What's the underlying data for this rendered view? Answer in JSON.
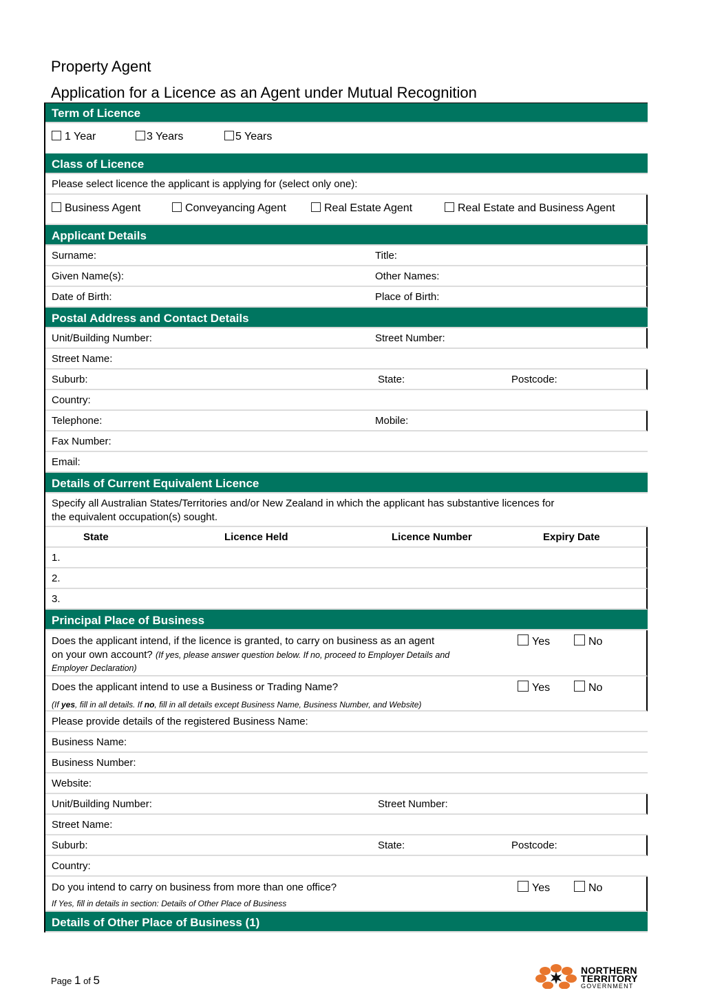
{
  "document": {
    "title": "Property Agent",
    "subtitle": "Application for a Licence as an Agent under Mutual Recognition",
    "accent_color": "#007560"
  },
  "term_of_licence": {
    "heading": "Term of Licence",
    "options": [
      "1 Year",
      "3 Years",
      "5 Years"
    ]
  },
  "class_of_licence": {
    "heading": "Class of Licence",
    "instruction": "Please select licence the applicant is applying for (select only one):",
    "options": [
      "Business Agent",
      "Conveyancing Agent",
      "Real Estate Agent",
      "Real Estate and Business Agent"
    ]
  },
  "applicant_details": {
    "heading": "Applicant Details",
    "surname": "Surname:",
    "title": "Title:",
    "given_names": "Given Name(s):",
    "other_names": "Other Names:",
    "dob": "Date of Birth:",
    "pob": "Place of Birth:"
  },
  "postal": {
    "heading": "Postal Address and Contact Details",
    "unit": "Unit/Building Number:",
    "street_number": "Street Number:",
    "street_name": "Street Name:",
    "suburb": "Suburb:",
    "state": "State:",
    "postcode": "Postcode:",
    "country": "Country:",
    "telephone": "Telephone:",
    "mobile": "Mobile:",
    "fax": "Fax Number:",
    "email": "Email:"
  },
  "current_licence": {
    "heading": "Details of Current Equivalent Licence",
    "instruction_line1": "Specify all Australian States/Territories and/or New Zealand in which the applicant has substantive licences for",
    "instruction_line2": "the equivalent occupation(s) sought.",
    "columns": [
      "State",
      "Licence Held",
      "Licence Number",
      "Expiry Date"
    ],
    "rows": [
      "1.",
      "2.",
      "3."
    ]
  },
  "principal_place": {
    "heading": "Principal Place of Business",
    "q1_line1": "Does the applicant intend, if the licence is granted, to carry on business as an agent",
    "q1_line2": "on your own account?",
    "q1_note_line1": "(If yes, please answer question below. If no, proceed to Employer Details and",
    "q1_note_line2": "Employer Declaration)",
    "q2": "Does the applicant intend to use a Business or Trading Name?",
    "q2_note_a": "(If ",
    "q2_note_yes": "yes",
    "q2_note_b": ", fill in all details. If ",
    "q2_note_no": "no",
    "q2_note_c": ", fill in all details except Business Name, Business Number, and Website)",
    "yes": "Yes",
    "no": "No",
    "registered_prompt": "Please provide details of the registered Business Name:",
    "business_name": "Business Name:",
    "business_number": "Business Number:",
    "website": "Website:",
    "unit": "Unit/Building Number:",
    "street_number": "Street Number:",
    "street_name": "Street Name:",
    "suburb": "Suburb:",
    "state": "State:",
    "postcode": "Postcode:",
    "country": "Country:",
    "q3": "Do you intend to carry on business from more than one office?",
    "q3_note": "If Yes, fill in details in section: Details of Other Place of Business"
  },
  "other_place": {
    "heading": "Details of Other Place of Business (1)"
  },
  "footer": {
    "page_prefix": "Page ",
    "page_current": "1",
    "page_of": " of ",
    "page_total": "5",
    "logo_line1": "NORTHERN",
    "logo_line2": "TERRITORY",
    "logo_line3": "GOVERNMENT"
  }
}
